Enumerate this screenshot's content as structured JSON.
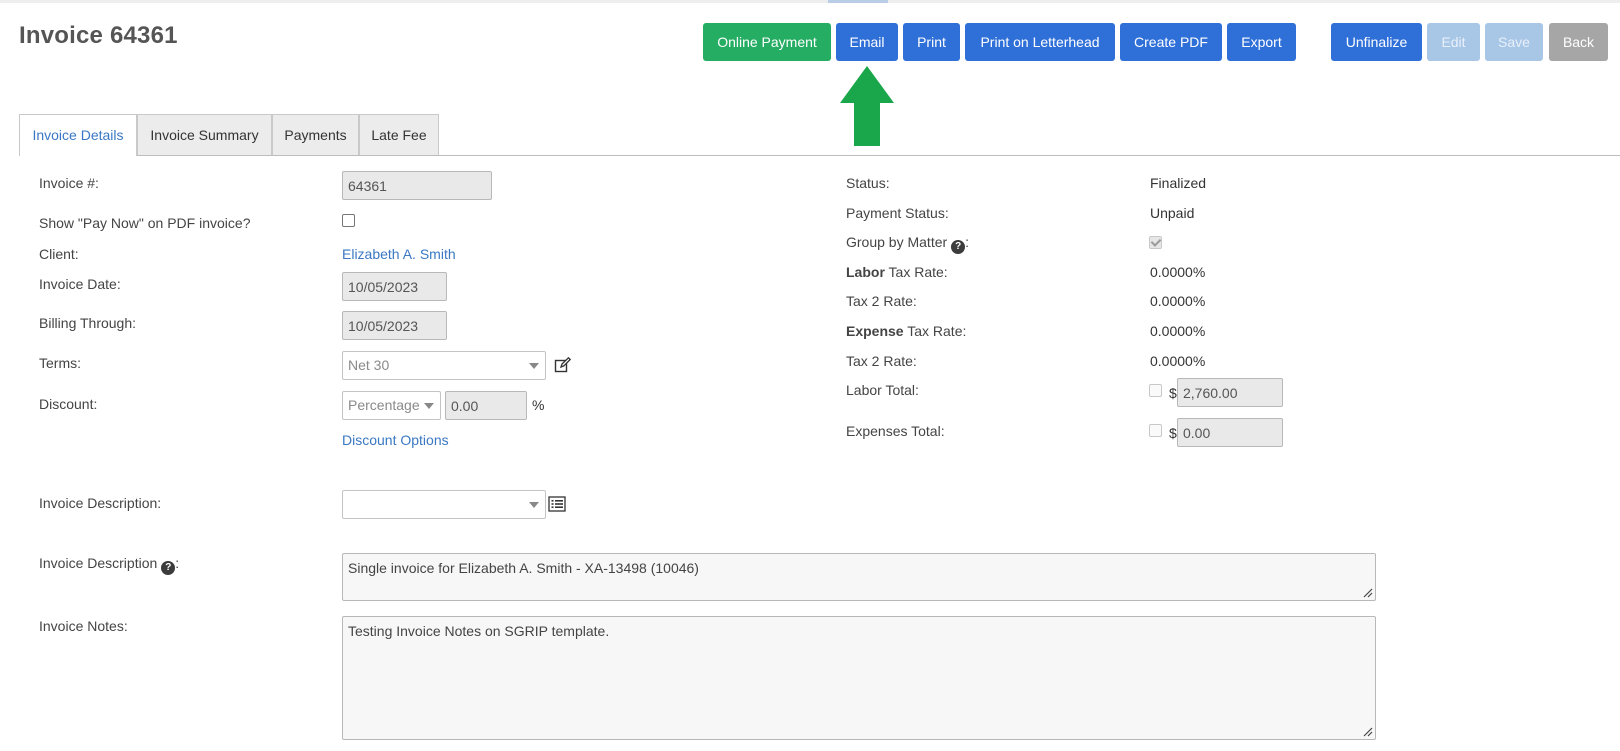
{
  "page": {
    "title": "Invoice 64361"
  },
  "toolbar": {
    "online_payment": "Online Payment",
    "email": "Email",
    "print": "Print",
    "print_letterhead": "Print on Letterhead",
    "create_pdf": "Create PDF",
    "export": "Export",
    "unfinalize": "Unfinalize",
    "edit": "Edit",
    "save": "Save",
    "back": "Back"
  },
  "tabs": [
    "Invoice Details",
    "Invoice Summary",
    "Payments",
    "Late Fee"
  ],
  "left": {
    "invoice_no_label": "Invoice #:",
    "invoice_no": "64361",
    "pay_now_label": "Show \"Pay Now\" on PDF invoice?",
    "client_label": "Client:",
    "client": "Elizabeth A. Smith",
    "invoice_date_label": "Invoice Date:",
    "invoice_date": "10/05/2023",
    "billing_through_label": "Billing Through:",
    "billing_through": "10/05/2023",
    "terms_label": "Terms:",
    "terms": "Net 30",
    "discount_label": "Discount:",
    "discount_type": "Percentage",
    "discount_value": "0.00",
    "discount_unit": "%",
    "discount_options": "Discount Options",
    "desc_select_label": "Invoice Description:",
    "desc_label": "Invoice Description",
    "desc_label_suffix": ":",
    "desc_text": "Single invoice for Elizabeth A. Smith - XA-13498 (10046)",
    "notes_label": "Invoice Notes:",
    "notes_text": "Testing Invoice Notes on SGRIP template."
  },
  "right": {
    "status_label": "Status:",
    "status": "Finalized",
    "payment_status_label": "Payment Status:",
    "payment_status": "Unpaid",
    "group_by_matter_label": "Group by Matter",
    "group_by_matter_suffix": ":",
    "labor_tax_bold": "Labor",
    "labor_tax_rest": " Tax Rate:",
    "labor_tax": "0.0000%",
    "tax2_label": "Tax 2 Rate:",
    "tax2": "0.0000%",
    "expense_tax_bold": "Expense",
    "expense_tax_rest": " Tax Rate:",
    "expense_tax": "0.0000%",
    "tax2b_label": "Tax 2 Rate:",
    "tax2b": "0.0000%",
    "labor_total_label": "Labor Total:",
    "labor_total": "2,760.00",
    "expenses_total_label": "Expenses Total:",
    "expenses_total": "0.00",
    "currency": "$"
  },
  "icons": {
    "question": "?",
    "edit": "edit-icon",
    "list": "list-icon",
    "arrow": "arrow-up-icon"
  },
  "colors": {
    "green": "#25ad63",
    "blue": "#2f6fd8",
    "disabled": "#a8c6e6",
    "gray": "#a6a6a6",
    "link": "#3a78c3",
    "arrow": "#1aa64a"
  }
}
